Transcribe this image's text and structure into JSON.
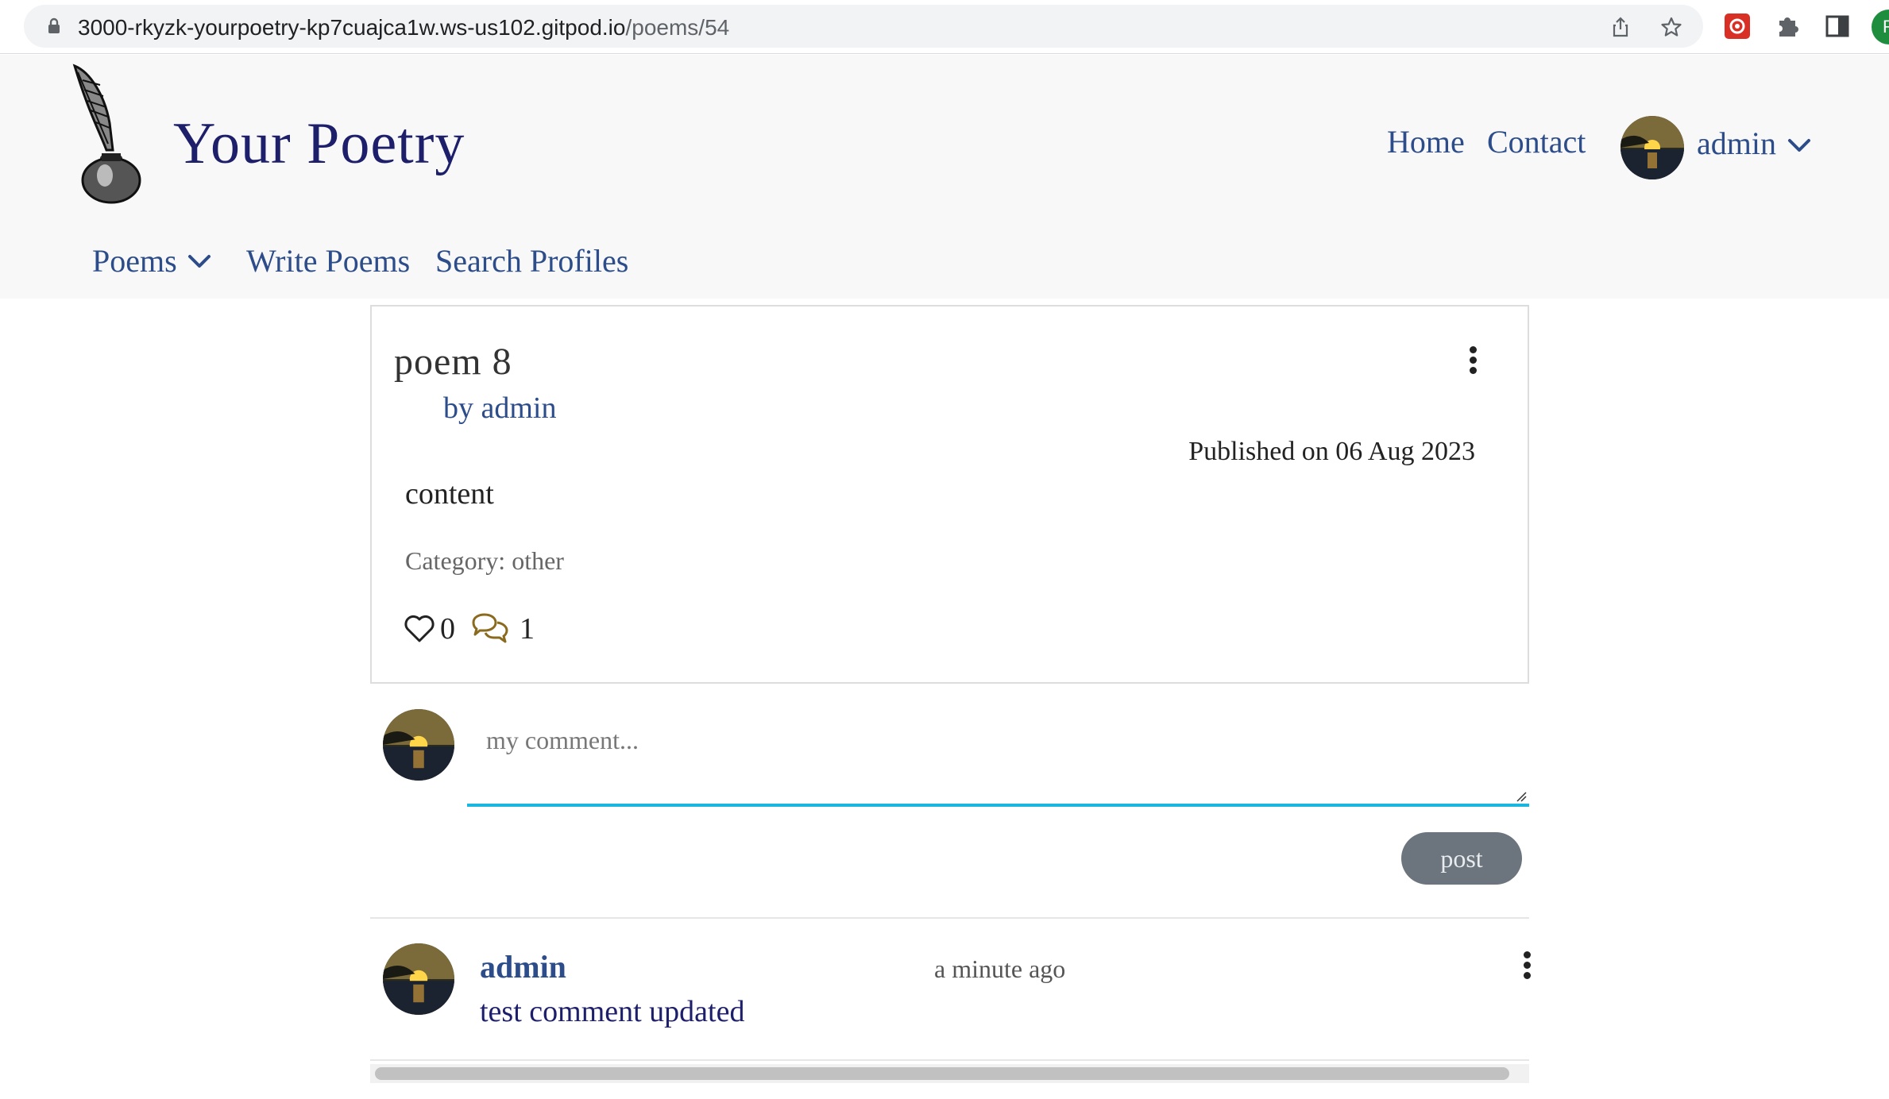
{
  "browser": {
    "url_host": "3000-rkyzk-yourpoetry-kp7cuajca1w.ws-us102.gitpod.io",
    "url_path": "/poems/54",
    "profile_initial": "R"
  },
  "header": {
    "brand": "Your Poetry",
    "nav_home": "Home",
    "nav_contact": "Contact",
    "user_name": "admin"
  },
  "subnav": {
    "poems": "Poems",
    "write_poems": "Write Poems",
    "search_profiles": "Search Profiles"
  },
  "poem": {
    "title": "poem 8",
    "byline": "by admin",
    "published": "Published on 06 Aug 2023",
    "content": "content",
    "category": "Category: other",
    "likes": "0",
    "comments": "1"
  },
  "comment_form": {
    "placeholder": "my comment...",
    "value": "",
    "post_label": "post"
  },
  "comment_list": [
    {
      "author": "admin",
      "time": "a minute ago",
      "text": "test comment updated"
    }
  ],
  "icons": [
    "lock-icon",
    "share-icon",
    "star-icon",
    "extension-icon",
    "puzzle-icon",
    "side-panel-icon",
    "quill-inkwell-logo",
    "chevron-down-icon",
    "kebab-menu-icon",
    "heart-icon",
    "comments-icon"
  ]
}
